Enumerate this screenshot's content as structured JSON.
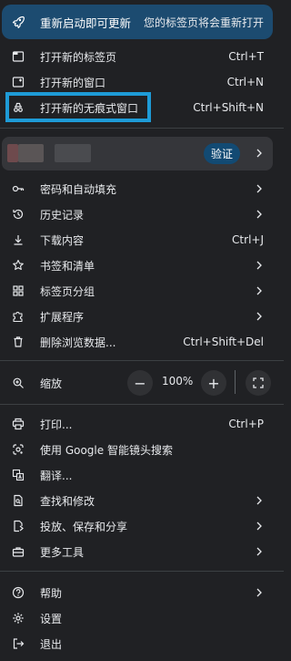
{
  "update": {
    "left": "重新启动即可更新",
    "right": "您的标签页将会重新打开"
  },
  "items_top": [
    {
      "label": "打开新的标签页",
      "shortcut": "Ctrl+T"
    },
    {
      "label": "打开新的窗口",
      "shortcut": "Ctrl+N"
    },
    {
      "label": "打开新的无痕式窗口",
      "shortcut": "Ctrl+Shift+N"
    }
  ],
  "profile": {
    "verify": "验证"
  },
  "items_mid": [
    {
      "label": "密码和自动填充"
    },
    {
      "label": "历史记录"
    },
    {
      "label": "下载内容",
      "shortcut": "Ctrl+J"
    },
    {
      "label": "书签和清单"
    },
    {
      "label": "标签页分组"
    },
    {
      "label": "扩展程序"
    },
    {
      "label": "删除浏览数据...",
      "shortcut": "Ctrl+Shift+Del"
    }
  ],
  "zoom": {
    "label": "缩放",
    "minus": "−",
    "value": "100%",
    "plus": "+"
  },
  "items_tools": [
    {
      "label": "打印...",
      "shortcut": "Ctrl+P"
    },
    {
      "label": "使用 Google 智能镜头搜索"
    },
    {
      "label": "翻译..."
    },
    {
      "label": "查找和修改"
    },
    {
      "label": "投放、保存和分享"
    },
    {
      "label": "更多工具"
    }
  ],
  "items_bottom": [
    {
      "label": "帮助"
    },
    {
      "label": "设置"
    },
    {
      "label": "退出"
    }
  ]
}
